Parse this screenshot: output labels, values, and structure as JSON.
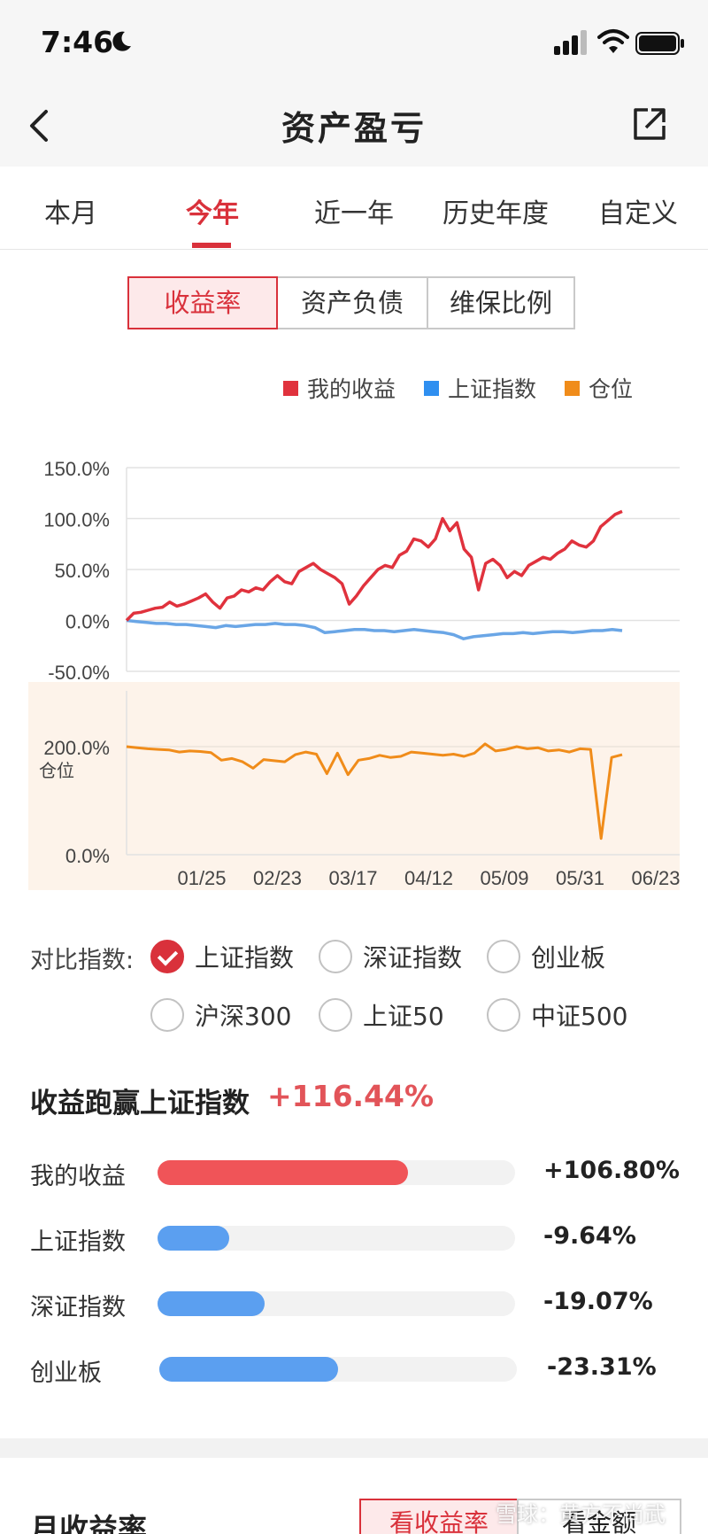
{
  "status": {
    "time": "7:46"
  },
  "nav": {
    "title": "资产盈亏"
  },
  "tabs": [
    {
      "label": "本月",
      "active": false
    },
    {
      "label": "今年",
      "active": true
    },
    {
      "label": "近一年",
      "active": false
    },
    {
      "label": "历史年度",
      "active": false
    },
    {
      "label": "自定义",
      "active": false
    }
  ],
  "segments": [
    {
      "label": "收益率",
      "active": true
    },
    {
      "label": "资产负债",
      "active": false
    },
    {
      "label": "维保比例",
      "active": false
    }
  ],
  "legend": [
    {
      "label": "我的收益",
      "color": "#e0323d"
    },
    {
      "label": "上证指数",
      "color": "#2f8ff0"
    },
    {
      "label": "仓位",
      "color": "#f08c1a"
    }
  ],
  "chart_data": [
    {
      "type": "line",
      "x_tick_labels": [
        "01/25",
        "02/23",
        "03/17",
        "04/12",
        "05/09",
        "05/31",
        "06/23"
      ],
      "y_tick_labels": [
        "150.0%",
        "100.0%",
        "50.0%",
        "0.0%",
        "-50.0%"
      ],
      "ylim": [
        -50,
        150
      ],
      "grid": true,
      "legend_position": "top-right",
      "series": [
        {
          "name": "我的收益",
          "color": "#e0323d",
          "values": [
            0,
            7,
            8,
            10,
            12,
            13,
            18,
            14,
            16,
            19,
            22,
            26,
            18,
            12,
            22,
            24,
            30,
            28,
            32,
            30,
            38,
            44,
            38,
            36,
            48,
            52,
            56,
            50,
            46,
            42,
            36,
            16,
            24,
            34,
            42,
            50,
            54,
            52,
            64,
            68,
            80,
            78,
            72,
            80,
            100,
            88,
            96,
            70,
            62,
            30,
            56,
            60,
            54,
            42,
            48,
            44,
            54,
            58,
            62,
            60,
            66,
            70,
            78,
            74,
            72,
            78,
            92,
            98,
            104,
            107
          ]
        },
        {
          "name": "上证指数",
          "color": "#6aa6e6",
          "values": [
            0,
            -1,
            -2,
            -3,
            -3,
            -4,
            -4,
            -5,
            -6,
            -7,
            -5,
            -6,
            -5,
            -4,
            -4,
            -3,
            -4,
            -4,
            -5,
            -7,
            -12,
            -11,
            -10,
            -9,
            -9,
            -10,
            -10,
            -11,
            -10,
            -9,
            -10,
            -11,
            -12,
            -14,
            -18,
            -16,
            -15,
            -14,
            -13,
            -13,
            -12,
            -13,
            -12,
            -11,
            -11,
            -12,
            -11,
            -10,
            -10,
            -9,
            -10
          ]
        }
      ]
    },
    {
      "type": "line",
      "y_tick_labels": [
        "200.0%",
        "0.0%"
      ],
      "ylabel": "仓位",
      "ylim": [
        0,
        300
      ],
      "series": [
        {
          "name": "仓位",
          "color": "#f08c1a",
          "values": [
            200,
            198,
            196,
            195,
            194,
            190,
            192,
            191,
            189,
            175,
            178,
            172,
            160,
            176,
            174,
            172,
            185,
            190,
            186,
            150,
            188,
            148,
            175,
            178,
            184,
            180,
            182,
            190,
            188,
            186,
            184,
            186,
            182,
            188,
            205,
            192,
            195,
            200,
            196,
            198,
            192,
            194,
            190,
            196,
            195,
            30,
            180,
            185
          ]
        }
      ]
    }
  ],
  "compare": {
    "label": "对比指数:",
    "options": [
      {
        "label": "上证指数",
        "checked": true
      },
      {
        "label": "深证指数",
        "checked": false
      },
      {
        "label": "创业板",
        "checked": false
      },
      {
        "label": "沪深300",
        "checked": false
      },
      {
        "label": "上证50",
        "checked": false
      },
      {
        "label": "中证500",
        "checked": false
      }
    ]
  },
  "outperform": {
    "label": "收益跑赢上证指数",
    "value": "+116.44%"
  },
  "bars": [
    {
      "label": "我的收益",
      "value": "+106.80%",
      "fraction": 0.7,
      "color": "#f05458"
    },
    {
      "label": "上证指数",
      "value": "-9.64%",
      "fraction": 0.2,
      "color": "#5b9ff0"
    },
    {
      "label": "深证指数",
      "value": "-19.07%",
      "fraction": 0.3,
      "color": "#5b9ff0"
    },
    {
      "label": "创业板",
      "value": "-23.31%",
      "fraction": 0.5,
      "color": "#5b9ff0"
    }
  ],
  "monthly": {
    "title": "月收益率",
    "rate_button": "看收益率",
    "amount_button": "看金额"
  },
  "watermark": "雪球：黄方不尚武"
}
